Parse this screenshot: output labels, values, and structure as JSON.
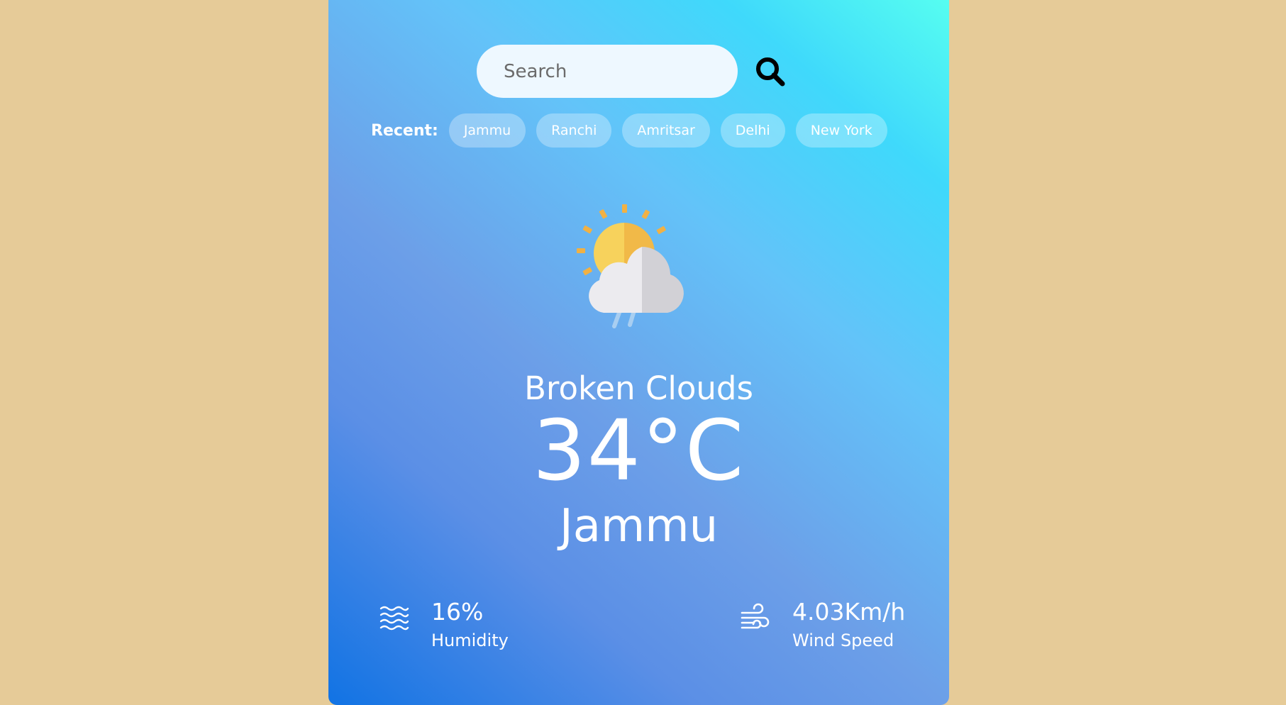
{
  "search": {
    "placeholder": "Search",
    "value": ""
  },
  "recent": {
    "label": "Recent:",
    "cities": [
      "Jammu",
      "Ranchi",
      "Amritsar",
      "Delhi",
      "New York"
    ]
  },
  "weather": {
    "icon": "sun-cloud-rain-icon",
    "condition": "Broken Clouds",
    "temperature": "34°C",
    "city": "Jammu"
  },
  "stats": {
    "humidity": {
      "value": "16%",
      "label": "Humidity",
      "icon": "humidity-waves-icon"
    },
    "wind": {
      "value": "4.03Km/h",
      "label": "Wind Speed",
      "icon": "wind-icon"
    }
  },
  "colors": {
    "page_background": "#e6cb98",
    "card_gradient": [
      "#57fff0",
      "#63c3f9",
      "#6c9fe8",
      "#1173e4"
    ],
    "search_field": "#eef8ff",
    "text": "#ffffff"
  }
}
